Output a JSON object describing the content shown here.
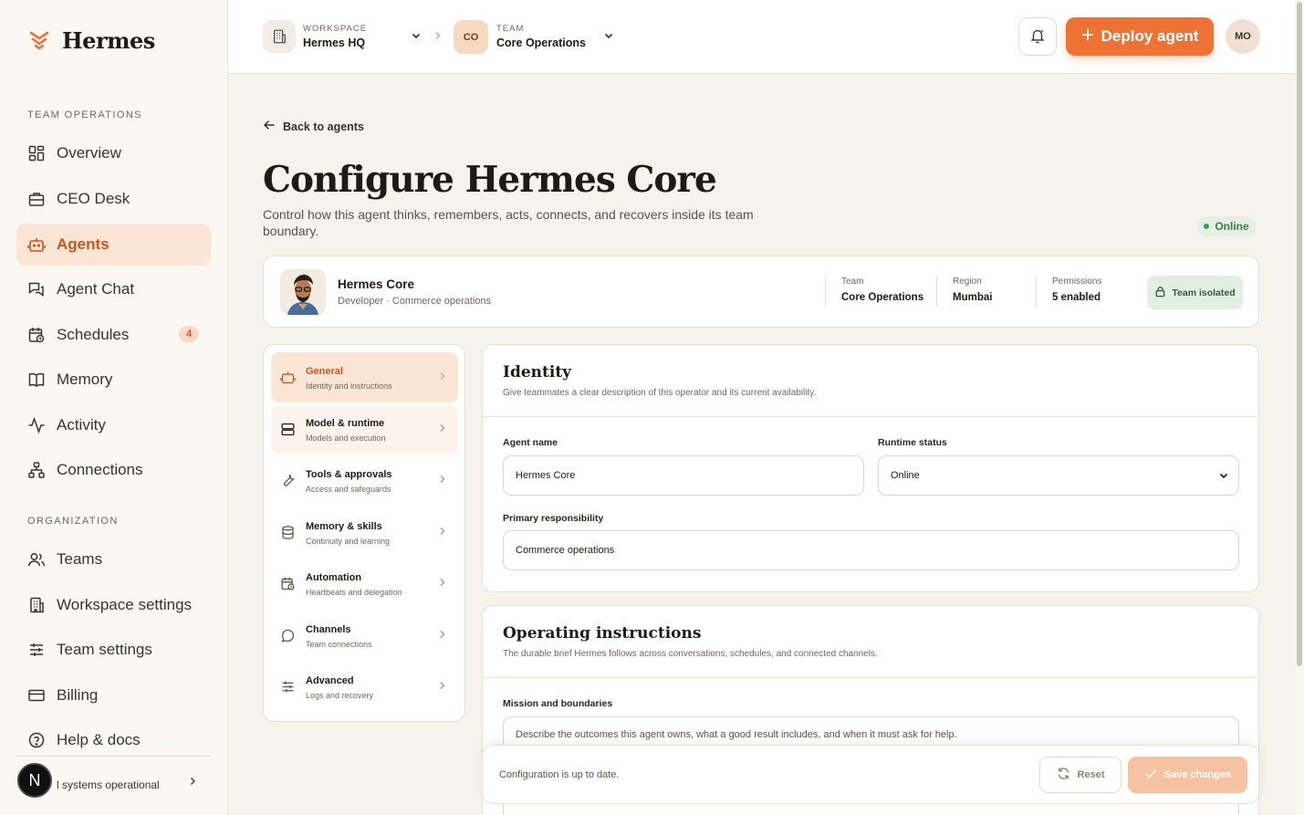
{
  "brand": {
    "name": "Hermes"
  },
  "sidebar": {
    "team_section": "TEAM OPERATIONS",
    "team_items": [
      {
        "label": "Overview",
        "icon": "grid-icon"
      },
      {
        "label": "CEO Desk",
        "icon": "briefcase-icon"
      },
      {
        "label": "Agents",
        "icon": "bot-icon",
        "active": true
      },
      {
        "label": "Agent Chat",
        "icon": "chat-icon"
      },
      {
        "label": "Schedules",
        "icon": "calendar-clock-icon",
        "badge": "4"
      },
      {
        "label": "Memory",
        "icon": "book-icon"
      },
      {
        "label": "Activity",
        "icon": "activity-icon"
      },
      {
        "label": "Connections",
        "icon": "network-icon"
      }
    ],
    "org_section": "ORGANIZATION",
    "org_items": [
      {
        "label": "Teams",
        "icon": "users-icon"
      },
      {
        "label": "Workspace settings",
        "icon": "building-icon"
      },
      {
        "label": "Team settings",
        "icon": "sliders-icon"
      },
      {
        "label": "Billing",
        "icon": "credit-card-icon"
      },
      {
        "label": "Help & docs",
        "icon": "help-icon"
      }
    ],
    "status_text": "l systems operational",
    "dev_badge": "N"
  },
  "header": {
    "workspace_label": "WORKSPACE",
    "workspace_value": "Hermes HQ",
    "team_label": "TEAM",
    "team_value": "Core Operations",
    "team_initials": "CO",
    "deploy_label": "Deploy agent",
    "user_initials": "MO"
  },
  "page": {
    "back_label": "Back to agents",
    "title": "Configure Hermes Core",
    "subtitle": "Control how this agent thinks, remembers, acts, connects, and recovers inside its team boundary.",
    "status_pill": "Online"
  },
  "agent": {
    "name": "Hermes Core",
    "role": "Developer · Commerce operations",
    "team_key": "Team",
    "team_value": "Core Operations",
    "region_key": "Region",
    "region_value": "Mumbai",
    "perm_key": "Permissions",
    "perm_value": "5 enabled",
    "isolation": "Team isolated"
  },
  "settings_nav": [
    {
      "title": "General",
      "desc": "Identity and instructions",
      "icon": "bot-icon",
      "state": "active"
    },
    {
      "title": "Model & runtime",
      "desc": "Models and execution",
      "icon": "server-icon",
      "state": "hover"
    },
    {
      "title": "Tools & approvals",
      "desc": "Access and safeguards",
      "icon": "wrench-icon"
    },
    {
      "title": "Memory & skills",
      "desc": "Continuity and learning",
      "icon": "database-icon"
    },
    {
      "title": "Automation",
      "desc": "Heartbeats and delegation",
      "icon": "calendar-clock-icon"
    },
    {
      "title": "Channels",
      "desc": "Team connections",
      "icon": "message-circle-icon"
    },
    {
      "title": "Advanced",
      "desc": "Logs and recovery",
      "icon": "sliders-icon"
    }
  ],
  "identity": {
    "title": "Identity",
    "desc": "Give teammates a clear description of this operator and its current availability.",
    "name_label": "Agent name",
    "name_value": "Hermes Core",
    "status_label": "Runtime status",
    "status_value": "Online",
    "resp_label": "Primary responsibility",
    "resp_value": "Commerce operations"
  },
  "instructions": {
    "title": "Operating instructions",
    "desc": "The durable brief Hermes follows across conversations, schedules, and connected channels.",
    "mission_label": "Mission and boundaries",
    "mission_placeholder": "Describe the outcomes this agent owns, what a good result includes, and when it must ask for help."
  },
  "save_bar": {
    "message": "Configuration is up to date.",
    "reset_label": "Reset",
    "save_label": "Save changes"
  },
  "colors": {
    "accent": "#ed7233",
    "accent_soft": "#fbe6d6",
    "success": "#3f9a52"
  }
}
